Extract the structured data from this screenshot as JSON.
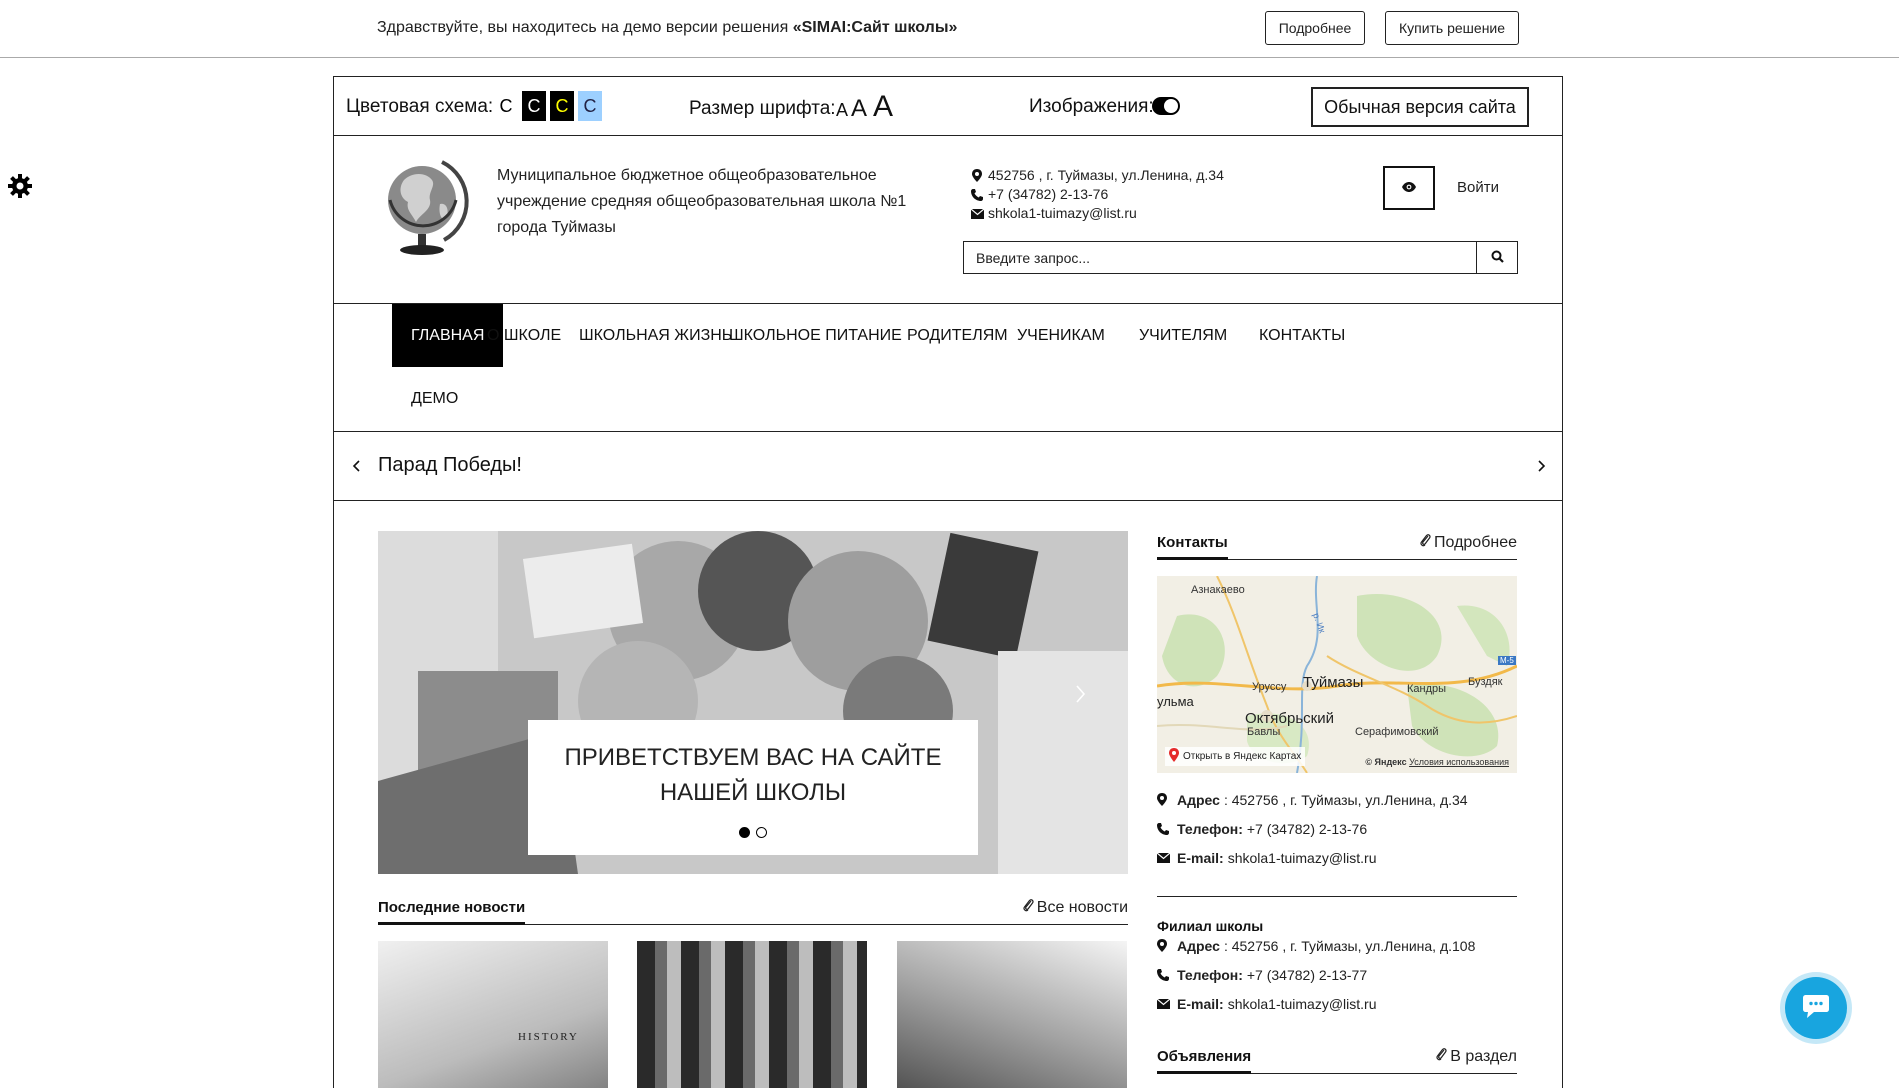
{
  "demo_bar": {
    "text_prefix": "Здравствуйте, вы находитесь на демо версии решения ",
    "text_strong": "«SIMAI:Сайт школы»",
    "more_label": "Подробнее",
    "buy_label": "Купить решение"
  },
  "accessibility": {
    "scheme_label": "Цветовая схема:",
    "swatches": [
      "C",
      "C",
      "C",
      "C"
    ],
    "font_label": "Размер шрифта:",
    "font_sizes": [
      "A",
      "A",
      "A"
    ],
    "images_label": "Изображения:",
    "normal_version_label": "Обычная версия сайта"
  },
  "header": {
    "school_name": "Муниципальное бюджетное общеобразовательное учреждение средняя общеобразовательная школа №1 города Туймазы",
    "address": "452756 , г. Туймазы, ул.Ленина, д.34",
    "phone": "+7 (34782) 2-13-76",
    "email": "shkola1-tuimazy@list.ru",
    "login_label": "Войти",
    "search_placeholder": "Введите запрос..."
  },
  "nav": {
    "items": [
      "ГЛАВНАЯ",
      "О ШКОЛЕ",
      "ШКОЛЬНАЯ ЖИЗНЬ",
      "ШКОЛЬНОЕ ПИТАНИЕ",
      "РОДИТЕЛЯМ",
      "УЧЕНИКАМ",
      "УЧИТЕЛЯМ",
      "КОНТАКТЫ",
      "ДЕМО"
    ],
    "active_index": 0
  },
  "slider": {
    "title": "Парад Победы!"
  },
  "hero": {
    "caption": "ПРИВЕТСТВУЕМ ВАС НА САЙТЕ НАШЕЙ ШКОЛЫ",
    "dots": 2,
    "active_dot": 0
  },
  "news": {
    "title": "Последние новости",
    "all_link": "Все новости",
    "book_text": "HISTORY"
  },
  "contacts_block": {
    "title": "Контакты",
    "more_link": "Подробнее",
    "map": {
      "labels": [
        "Азнакаево",
        "Туймазы",
        "Октябрьский",
        "Уруссу",
        "Кандры",
        "Буздяк",
        "Серафимовский",
        "Бавлы",
        "ульма",
        "р. Ик",
        "М-5"
      ],
      "open_link": "Открыть в Яндекс Картах",
      "copyright": "© Яндекс",
      "terms": "Условия использования"
    },
    "main": {
      "address_label": "Адрес",
      "address": ": 452756 , г. Туймазы, ул.Ленина, д.34",
      "phone_label": "Телефон:",
      "phone": "+7 (34782) 2-13-76",
      "email_label": "E-mail:",
      "email": "shkola1-tuimazy@list.ru"
    },
    "branch_title": "Филиал школы",
    "branch": {
      "address_label": "Адрес",
      "address": ": 452756 , г. Туймазы, ул.Ленина, д.108",
      "phone_label": "Телефон:",
      "phone": "+7 (34782) 2-13-77",
      "email_label": "E-mail:",
      "email": "shkola1-tuimazy@list.ru"
    }
  },
  "ads_block": {
    "title": "Объявления",
    "link": "В раздел"
  },
  "colors": {
    "chat_accent": "#18a5df",
    "swatch_light_blue": "#9dd0ff",
    "swatch_yellow_text": "#ffff00"
  }
}
